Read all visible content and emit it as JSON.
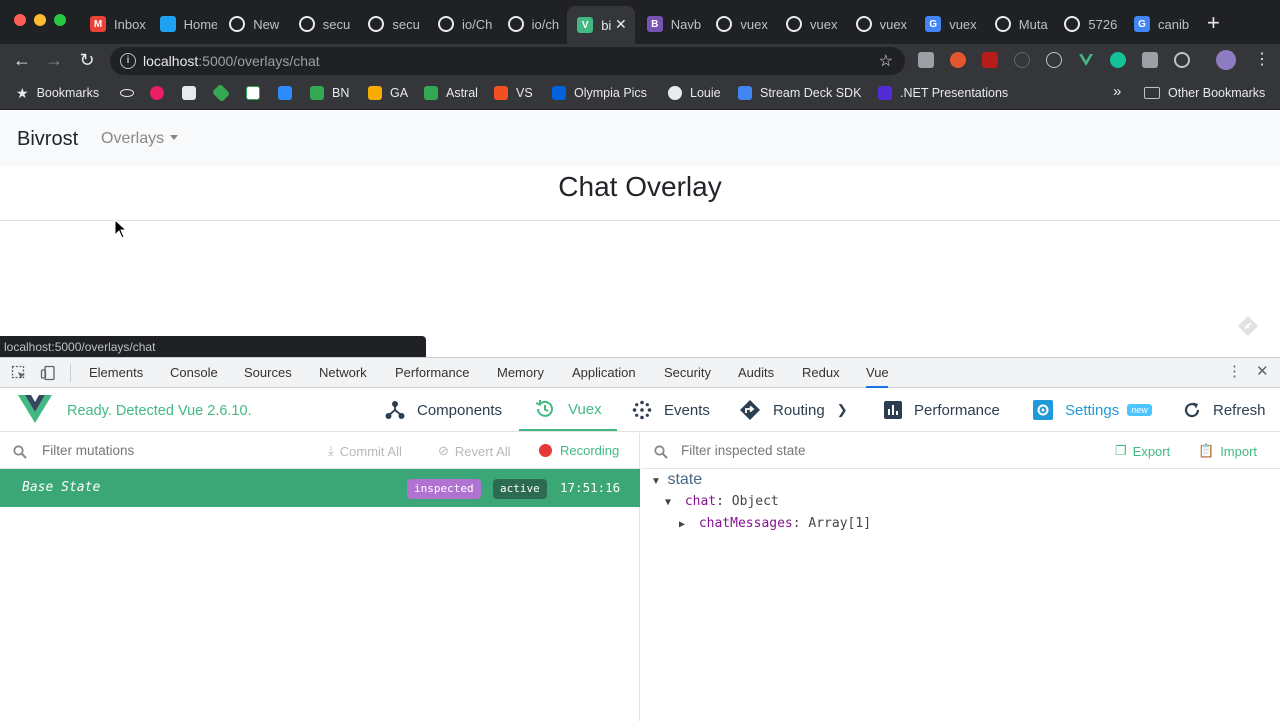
{
  "browser": {
    "tabs": [
      {
        "title": "Inbox",
        "icon": "gmail-icon",
        "color": "#ea4335",
        "glyph": "M"
      },
      {
        "title": "Home",
        "icon": "twitter-icon",
        "color": "#1da1f2",
        "glyph": ""
      },
      {
        "title": "New",
        "icon": "github-icon",
        "color": "#e8eaed",
        "glyph": ""
      },
      {
        "title": "secu",
        "icon": "github-icon",
        "color": "#e8eaed",
        "glyph": ""
      },
      {
        "title": "secu",
        "icon": "github-icon",
        "color": "#e8eaed",
        "glyph": ""
      },
      {
        "title": "io/Ch",
        "icon": "github-icon",
        "color": "#e8eaed",
        "glyph": ""
      },
      {
        "title": "io/ch",
        "icon": "github-icon",
        "color": "#e8eaed",
        "glyph": ""
      },
      {
        "title": "bi",
        "icon": "vue-icon",
        "color": "#42b883",
        "glyph": "V"
      },
      {
        "title": "Navb",
        "icon": "bootstrap-icon",
        "color": "#7952b3",
        "glyph": "B"
      },
      {
        "title": "vuex",
        "icon": "github-icon",
        "color": "#e8eaed",
        "glyph": ""
      },
      {
        "title": "vuex",
        "icon": "github-icon",
        "color": "#e8eaed",
        "glyph": ""
      },
      {
        "title": "vuex",
        "icon": "github-icon",
        "color": "#e8eaed",
        "glyph": ""
      },
      {
        "title": "vuex",
        "icon": "google-icon",
        "color": "#4285f4",
        "glyph": "G"
      },
      {
        "title": "Muta",
        "icon": "globe-icon",
        "color": "#e8eaed",
        "glyph": ""
      },
      {
        "title": "5726",
        "icon": "globe-icon",
        "color": "#e8eaed",
        "glyph": ""
      },
      {
        "title": "canib",
        "icon": "google-icon",
        "color": "#4285f4",
        "glyph": "G"
      }
    ],
    "active_tab": 7,
    "url_host": "localhost",
    "url_path": ":5000/overlays/chat",
    "bookmarks_label": "Bookmarks",
    "bookmarks": [
      "BN",
      "GA",
      "Astral",
      "VS",
      "Olympia Pics",
      "Louie",
      "Stream Deck SDK",
      ".NET Presentations"
    ],
    "other_bookmarks": "Other Bookmarks",
    "status_url": "localhost:5000/overlays/chat"
  },
  "page": {
    "brand": "Bivrost",
    "nav_overlays": "Overlays",
    "title": "Chat Overlay"
  },
  "devtools": {
    "tabs": [
      "Elements",
      "Console",
      "Sources",
      "Network",
      "Performance",
      "Memory",
      "Application",
      "Security",
      "Audits",
      "Redux",
      "Vue"
    ],
    "active_tab": "Vue",
    "vue": {
      "ready_text": "Ready. Detected Vue 2.6.10.",
      "nav": {
        "components": "Components",
        "vuex": "Vuex",
        "events": "Events",
        "routing": "Routing",
        "performance": "Performance",
        "settings": "Settings",
        "settings_badge": "new",
        "refresh": "Refresh"
      },
      "mutations": {
        "filter_placeholder": "Filter mutations",
        "commit_all": "Commit All",
        "revert_all": "Revert All",
        "recording": "Recording",
        "base_state": "Base State",
        "badge_inspected": "inspected",
        "badge_active": "active",
        "time": "17:51:16"
      },
      "state": {
        "filter_placeholder": "Filter inspected state",
        "export": "Export",
        "import": "Import",
        "root": "state",
        "chat_key": "chat",
        "chat_value": "Object",
        "messages_key": "chatMessages",
        "messages_value": "Array[1]"
      }
    }
  },
  "colors": {
    "vue_green": "#42b983",
    "mutation_row": "#3ba776",
    "inspected_badge": "#b073d2",
    "active_badge": "#2c6b51",
    "devtools_accent": "#1a73e8"
  }
}
